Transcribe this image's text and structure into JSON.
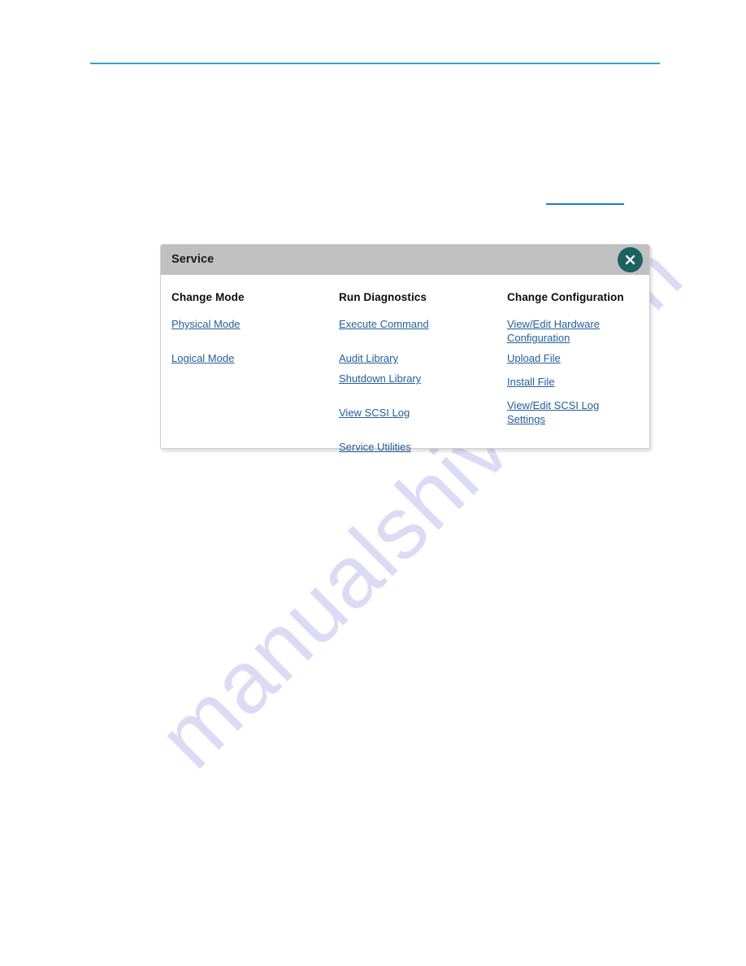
{
  "page": {
    "background": "#ffffff",
    "rule_color": "#2ca8c6",
    "link_color": "#225f9c",
    "titlebar_color": "#c0c0c0",
    "close_button_color": "#1b6260",
    "watermark_color": "#c9c6ee"
  },
  "watermark": {
    "text": "manualshive.com"
  },
  "header_link": {
    "text": ""
  },
  "panel": {
    "title": "Service",
    "close_icon": "close-x-icon",
    "columns": [
      {
        "id": "change-mode",
        "header": "Change Mode",
        "links": [
          {
            "label": "Physical Mode",
            "spacing": "gap-lg"
          },
          {
            "label": "Logical Mode",
            "spacing": "gap-lg"
          }
        ]
      },
      {
        "id": "run-diagnostics",
        "header": "Run Diagnostics",
        "links": [
          {
            "label": "Execute Command",
            "spacing": "gap-lg"
          },
          {
            "label": "Audit Library",
            "spacing": "gap-sm"
          },
          {
            "label": "Shutdown Library",
            "spacing": "gap-lg"
          },
          {
            "label": "View SCSI Log",
            "spacing": "gap-lg"
          },
          {
            "label": "Service Utilities",
            "spacing": "gap-lg"
          }
        ]
      },
      {
        "id": "change-configuration",
        "header": "Change Configuration",
        "links": [
          {
            "label": "View/Edit Hardware Configuration",
            "spacing": "wrap gap-sm"
          },
          {
            "label": "Upload File",
            "spacing": "gap-md"
          },
          {
            "label": "Install File",
            "spacing": "gap-md"
          },
          {
            "label": "View/Edit SCSI Log Settings",
            "spacing": "wrap gap-sm"
          }
        ]
      }
    ]
  }
}
